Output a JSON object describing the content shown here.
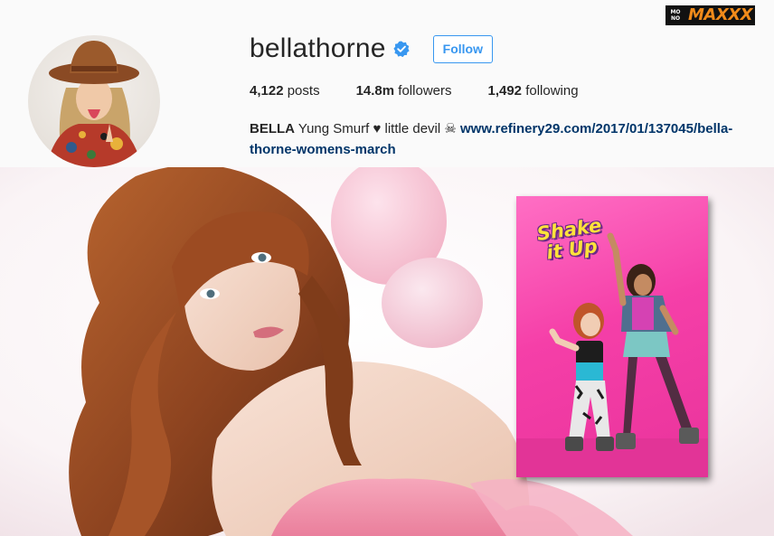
{
  "profile": {
    "username": "bellathorne",
    "follow_label": "Follow",
    "stats": {
      "posts_count": "4,122",
      "posts_label": "posts",
      "followers_count": "14.8m",
      "followers_label": "followers",
      "following_count": "1,492",
      "following_label": "following"
    },
    "bio": {
      "name": "BELLA",
      "text": " Yung Smurf ♥︎ little devil ☠ ",
      "link_line1": "www.refinery29.com/2017/01/137045/bella-",
      "link_line2": "thorne-womens-march"
    }
  },
  "watermark": {
    "mono_top": "MO",
    "mono_bottom": "NO",
    "maxxx": "MAXXX"
  },
  "poster": {
    "title_line1": "Shake",
    "title_line2": "it Up"
  },
  "colors": {
    "follow_blue": "#3897f0",
    "link_navy": "#003569",
    "poster_pink": "#f53fa8",
    "watermark_orange": "#f08a1a"
  }
}
